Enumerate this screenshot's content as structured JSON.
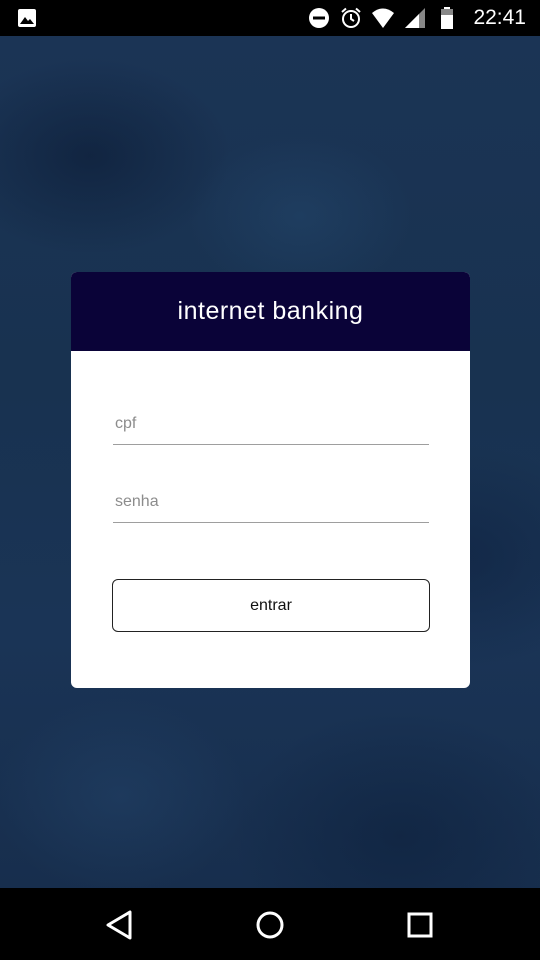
{
  "status_bar": {
    "time": "22:41",
    "icons": [
      "image-icon",
      "do-not-disturb-icon",
      "alarm-icon",
      "wifi-icon",
      "signal-icon",
      "battery-icon"
    ]
  },
  "login": {
    "title": "internet banking",
    "cpf_placeholder": "cpf",
    "senha_placeholder": "senha",
    "submit_label": "entrar"
  },
  "nav_bar": {
    "icons": [
      "back-icon",
      "home-icon",
      "recent-apps-icon"
    ]
  },
  "colors": {
    "header": "#0a0338",
    "background": "#1a3456",
    "card": "#ffffff"
  }
}
